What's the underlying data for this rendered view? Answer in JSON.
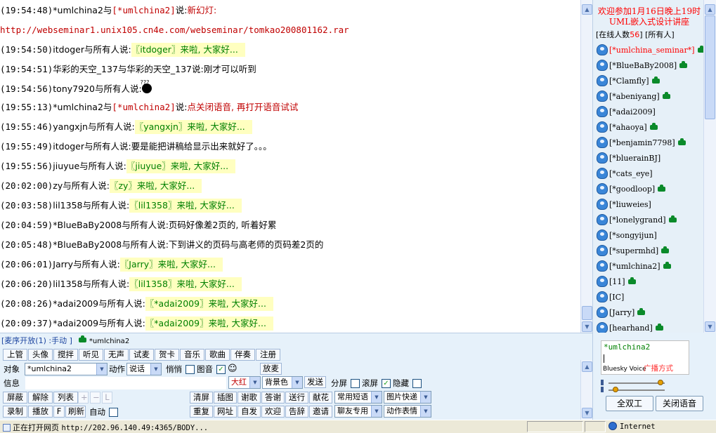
{
  "chat": {
    "messages": [
      {
        "time": "(19:54:48)",
        "from": "*umlchina2",
        "mid": "与",
        "to": "[*umlchina2]",
        "said": "说:",
        "text": "新幻灯:",
        "kind": "red"
      },
      {
        "time": "",
        "from": "",
        "mid": "",
        "to": "",
        "said": "",
        "text": "http://webseminar1.unix105.cn4e.com/webseminar/tomkao200801162.rar",
        "kind": "url"
      },
      {
        "time": "(19:54:50)",
        "from": "itdoger",
        "mid": "与所有人说:",
        "text": "〖itdoger〗来啦, 大家好...",
        "kind": "hl"
      },
      {
        "time": "(19:54:51)",
        "from": "华彩的天空_137",
        "mid": "与华彩的天空_137说:",
        "text": "刚才可以听到",
        "kind": "plain"
      },
      {
        "time": "(19:54:56)",
        "from": "tony7920",
        "mid": "与所有人说:",
        "text": "",
        "kind": "emoji",
        "emoji_label": "???"
      },
      {
        "time": "(19:55:13)",
        "from": "*umlchina2",
        "mid": "与",
        "to": "[*umlchina2]",
        "said": "说:",
        "text": "点关闭语音, 再打开语音试试",
        "kind": "red"
      },
      {
        "time": "(19:55:46)",
        "from": "yangxjn",
        "mid": "与所有人说:",
        "text": "〖yangxjn〗来啦, 大家好...",
        "kind": "hl"
      },
      {
        "time": "(19:55:49)",
        "from": "itdoger",
        "mid": "与所有人说:",
        "text": "要是能把讲稿给显示出来就好了。。。",
        "kind": "plain"
      },
      {
        "time": "(19:55:56)",
        "from": "jiuyue",
        "mid": "与所有人说:",
        "text": "〖jiuyue〗来啦, 大家好...",
        "kind": "hl"
      },
      {
        "time": "(20:02:00)",
        "from": "zy",
        "mid": "与所有人说:",
        "text": "〖zy〗来啦, 大家好...",
        "kind": "hl"
      },
      {
        "time": "(20:03:58)",
        "from": "lil1358",
        "mid": "与所有人说:",
        "text": "〖lil1358〗来啦, 大家好...",
        "kind": "hl"
      },
      {
        "time": "(20:04:59)",
        "from": "*BlueBaBy2008",
        "mid": "与所有人说:",
        "text": "页码好像差2页的, 听着好累",
        "kind": "plain"
      },
      {
        "time": "(20:05:48)",
        "from": "*BlueBaBy2008",
        "mid": "与所有人说:",
        "text": "下到讲义的页码与高老师的页码差2页的",
        "kind": "plain"
      },
      {
        "time": "(20:06:01)",
        "from": "Jarry",
        "mid": "与所有人说:",
        "text": "〖Jarry〗来啦, 大家好...",
        "kind": "hl"
      },
      {
        "time": "(20:06:20)",
        "from": "lil1358",
        "mid": "与所有人说:",
        "text": "〖lil1358〗来啦, 大家好...",
        "kind": "hl"
      },
      {
        "time": "(20:08:26)",
        "from": "*adai2009",
        "mid": "与所有人说:",
        "text": "〖*adai2009〗来啦, 大家好...",
        "kind": "hl"
      },
      {
        "time": "(20:09:37)",
        "from": "*adai2009",
        "mid": "与所有人说:",
        "text": "〖*adai2009〗来啦, 大家好...",
        "kind": "hl"
      }
    ]
  },
  "sidebar": {
    "event_line1": "欢迎参加1月16日晚上19时",
    "event_line2": "UML嵌入式设计讲座",
    "online_label": "[在线人数",
    "online_count": "56",
    "online_all": "] [所有人]",
    "users": [
      {
        "name": "[*umlchina_seminar*]",
        "red": true,
        "cam": true
      },
      {
        "name": "[*BlueBaBy2008]",
        "red": false,
        "cam": true
      },
      {
        "name": "[*Clamfly]",
        "red": false,
        "cam": true
      },
      {
        "name": "[*abeniyang]",
        "red": false,
        "cam": true
      },
      {
        "name": "[*adai2009]",
        "red": false,
        "cam": false
      },
      {
        "name": "[*ahaoya]",
        "red": false,
        "cam": true
      },
      {
        "name": "[*benjamin7798]",
        "red": false,
        "cam": true
      },
      {
        "name": "[*bluerainBJ]",
        "red": false,
        "cam": false
      },
      {
        "name": "[*cats_eye]",
        "red": false,
        "cam": false
      },
      {
        "name": "[*goodloop]",
        "red": false,
        "cam": true
      },
      {
        "name": "[*liuweies]",
        "red": false,
        "cam": false
      },
      {
        "name": "[*lonelygrand]",
        "red": false,
        "cam": true
      },
      {
        "name": "[*songyijun]",
        "red": false,
        "cam": false
      },
      {
        "name": "[*supermhd]",
        "red": false,
        "cam": true
      },
      {
        "name": "[*umlchina2]",
        "red": false,
        "cam": true
      },
      {
        "name": "[11]",
        "red": false,
        "cam": true
      },
      {
        "name": "[IC]",
        "red": false,
        "cam": false
      },
      {
        "name": "[Jarry]",
        "red": false,
        "cam": true
      },
      {
        "name": "[hearhand]",
        "red": false,
        "cam": true
      }
    ]
  },
  "controls": {
    "mic_status": "[麦序开放(1) :手动 ]",
    "mic_user": "*umlchina2",
    "row1": [
      "上管",
      "头像",
      "搅拌",
      "听见",
      "无声",
      "试麦",
      "贺卡",
      "音乐",
      "歌曲",
      "伴奏",
      "注册"
    ],
    "target_label": "对象",
    "target_value": "*umlchina2",
    "action_label": "动作",
    "action_value": "说话",
    "whisper_label": "悄悄",
    "image_label": "图音",
    "smiley": "☺",
    "mic_btn": "放麦",
    "msg_label": "信息",
    "font_size": "大红",
    "bg_color": "背景色",
    "send": "发送",
    "split": "分屏",
    "scroll": "滚屏",
    "hide": "隐藏",
    "row3": [
      "屏蔽",
      "解除",
      "列表"
    ],
    "row3b": [
      "清屏",
      "插图",
      "谢歌",
      "答谢",
      "送行",
      "献花"
    ],
    "phrases": "常用短语",
    "image_fast": "图片快递",
    "row4": [
      "录制",
      "播放",
      "F",
      "刷新"
    ],
    "auto_label": "自动",
    "row4b": [
      "重复",
      "网址",
      "自发",
      "欢迎",
      "告辞",
      "邀请"
    ],
    "friend_use": "聊友专用",
    "action_emote": "动作表情"
  },
  "voice": {
    "name": "*umlchina2",
    "brand": "Bluesky Voice",
    "mode": "广播方式",
    "full_duplex": "全双工",
    "close_voice": "关闭语音"
  },
  "statusbar": {
    "text": "正在打开网页",
    "url": "http://202.96.140.49:4365/BODY...",
    "zone": "Internet"
  }
}
